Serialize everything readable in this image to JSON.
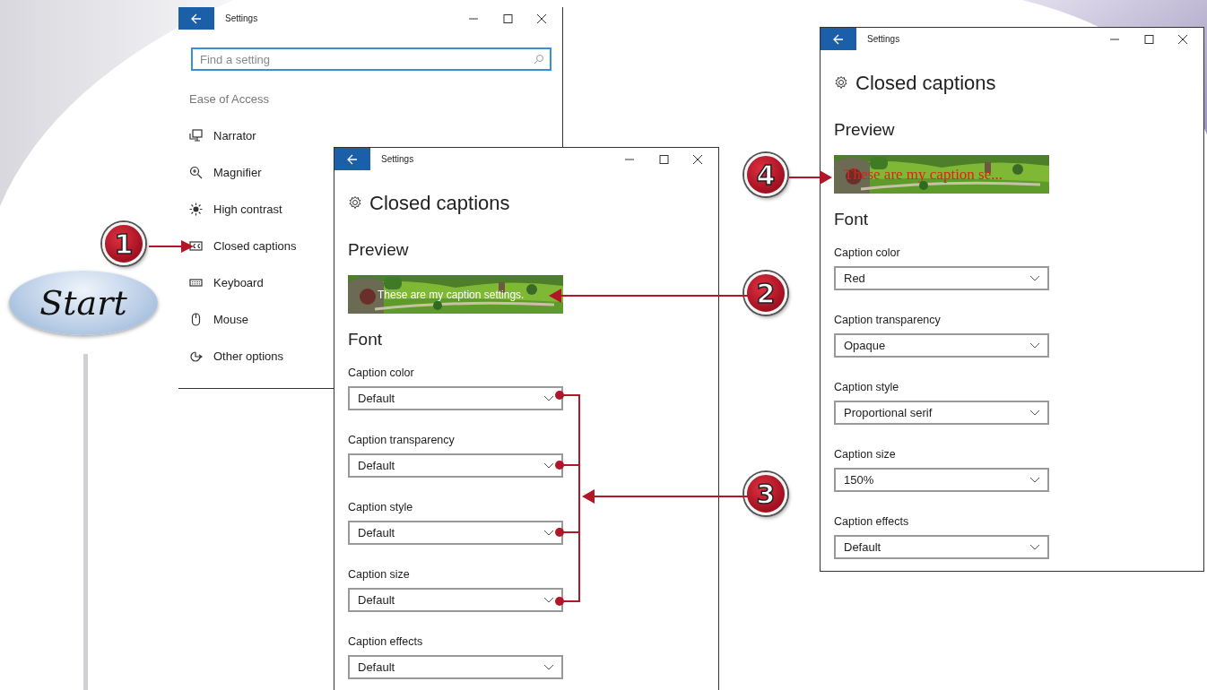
{
  "start_badge": {
    "label": "Start"
  },
  "windows": [
    {
      "kind": "menu",
      "title": "Settings",
      "search": {
        "placeholder": "Find a setting"
      },
      "section": "Ease of Access",
      "menu": [
        {
          "kind": "narrator",
          "label": "Narrator"
        },
        {
          "kind": "magnifier",
          "label": "Magnifier"
        },
        {
          "kind": "contrast",
          "label": "High contrast"
        },
        {
          "kind": "captions",
          "label": "Closed captions"
        },
        {
          "kind": "keyboard",
          "label": "Keyboard"
        },
        {
          "kind": "mouse",
          "label": "Mouse"
        },
        {
          "kind": "other",
          "label": "Other options"
        }
      ]
    },
    {
      "kind": "captions",
      "title": "Settings",
      "heading": "Closed captions",
      "preview_heading": "Preview",
      "preview": {
        "kind": "default",
        "caption": "These are my caption settings."
      },
      "font_heading": "Font",
      "settings": [
        {
          "label": "Caption color",
          "value": "Default"
        },
        {
          "label": "Caption transparency",
          "value": "Default"
        },
        {
          "label": "Caption style",
          "value": "Default"
        },
        {
          "label": "Caption size",
          "value": "Default"
        },
        {
          "label": "Caption effects",
          "value": "Default"
        }
      ]
    },
    {
      "kind": "captions",
      "title": "Settings",
      "heading": "Closed captions",
      "preview_heading": "Preview",
      "preview": {
        "kind": "red-serif",
        "caption": "These are my caption se..."
      },
      "font_heading": "Font",
      "settings": [
        {
          "label": "Caption color",
          "value": "Red"
        },
        {
          "label": "Caption transparency",
          "value": "Opaque"
        },
        {
          "label": "Caption style",
          "value": "Proportional serif"
        },
        {
          "label": "Caption size",
          "value": "150%"
        },
        {
          "label": "Caption effects",
          "value": "Default"
        }
      ]
    }
  ],
  "callouts": [
    {
      "number": "1"
    },
    {
      "number": "4"
    },
    {
      "number": "2"
    },
    {
      "number": "3"
    }
  ]
}
